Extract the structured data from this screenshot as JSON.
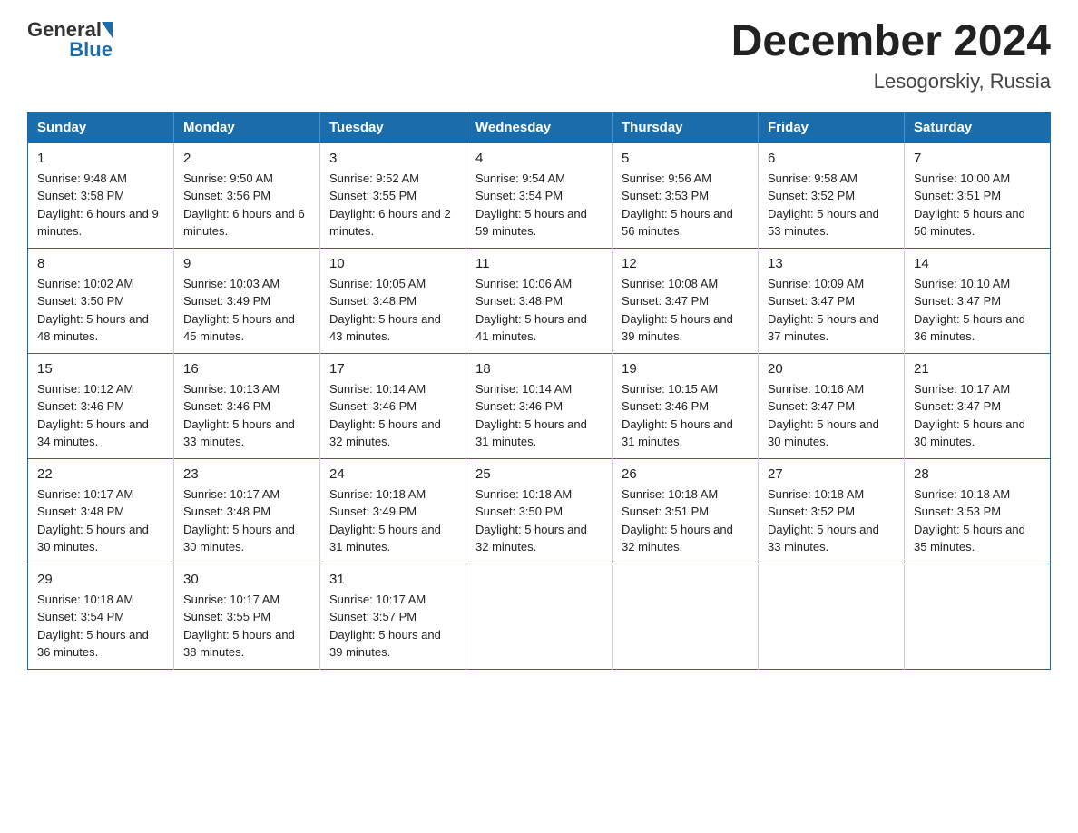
{
  "header": {
    "logo": {
      "text_general": "General",
      "text_blue": "Blue",
      "arrow_alt": "arrow icon"
    },
    "title": "December 2024",
    "subtitle": "Lesogorskiy, Russia"
  },
  "calendar": {
    "days_of_week": [
      "Sunday",
      "Monday",
      "Tuesday",
      "Wednesday",
      "Thursday",
      "Friday",
      "Saturday"
    ],
    "weeks": [
      [
        {
          "day": "1",
          "sunrise": "9:48 AM",
          "sunset": "3:58 PM",
          "daylight": "6 hours and 9 minutes."
        },
        {
          "day": "2",
          "sunrise": "9:50 AM",
          "sunset": "3:56 PM",
          "daylight": "6 hours and 6 minutes."
        },
        {
          "day": "3",
          "sunrise": "9:52 AM",
          "sunset": "3:55 PM",
          "daylight": "6 hours and 2 minutes."
        },
        {
          "day": "4",
          "sunrise": "9:54 AM",
          "sunset": "3:54 PM",
          "daylight": "5 hours and 59 minutes."
        },
        {
          "day": "5",
          "sunrise": "9:56 AM",
          "sunset": "3:53 PM",
          "daylight": "5 hours and 56 minutes."
        },
        {
          "day": "6",
          "sunrise": "9:58 AM",
          "sunset": "3:52 PM",
          "daylight": "5 hours and 53 minutes."
        },
        {
          "day": "7",
          "sunrise": "10:00 AM",
          "sunset": "3:51 PM",
          "daylight": "5 hours and 50 minutes."
        }
      ],
      [
        {
          "day": "8",
          "sunrise": "10:02 AM",
          "sunset": "3:50 PM",
          "daylight": "5 hours and 48 minutes."
        },
        {
          "day": "9",
          "sunrise": "10:03 AM",
          "sunset": "3:49 PM",
          "daylight": "5 hours and 45 minutes."
        },
        {
          "day": "10",
          "sunrise": "10:05 AM",
          "sunset": "3:48 PM",
          "daylight": "5 hours and 43 minutes."
        },
        {
          "day": "11",
          "sunrise": "10:06 AM",
          "sunset": "3:48 PM",
          "daylight": "5 hours and 41 minutes."
        },
        {
          "day": "12",
          "sunrise": "10:08 AM",
          "sunset": "3:47 PM",
          "daylight": "5 hours and 39 minutes."
        },
        {
          "day": "13",
          "sunrise": "10:09 AM",
          "sunset": "3:47 PM",
          "daylight": "5 hours and 37 minutes."
        },
        {
          "day": "14",
          "sunrise": "10:10 AM",
          "sunset": "3:47 PM",
          "daylight": "5 hours and 36 minutes."
        }
      ],
      [
        {
          "day": "15",
          "sunrise": "10:12 AM",
          "sunset": "3:46 PM",
          "daylight": "5 hours and 34 minutes."
        },
        {
          "day": "16",
          "sunrise": "10:13 AM",
          "sunset": "3:46 PM",
          "daylight": "5 hours and 33 minutes."
        },
        {
          "day": "17",
          "sunrise": "10:14 AM",
          "sunset": "3:46 PM",
          "daylight": "5 hours and 32 minutes."
        },
        {
          "day": "18",
          "sunrise": "10:14 AM",
          "sunset": "3:46 PM",
          "daylight": "5 hours and 31 minutes."
        },
        {
          "day": "19",
          "sunrise": "10:15 AM",
          "sunset": "3:46 PM",
          "daylight": "5 hours and 31 minutes."
        },
        {
          "day": "20",
          "sunrise": "10:16 AM",
          "sunset": "3:47 PM",
          "daylight": "5 hours and 30 minutes."
        },
        {
          "day": "21",
          "sunrise": "10:17 AM",
          "sunset": "3:47 PM",
          "daylight": "5 hours and 30 minutes."
        }
      ],
      [
        {
          "day": "22",
          "sunrise": "10:17 AM",
          "sunset": "3:48 PM",
          "daylight": "5 hours and 30 minutes."
        },
        {
          "day": "23",
          "sunrise": "10:17 AM",
          "sunset": "3:48 PM",
          "daylight": "5 hours and 30 minutes."
        },
        {
          "day": "24",
          "sunrise": "10:18 AM",
          "sunset": "3:49 PM",
          "daylight": "5 hours and 31 minutes."
        },
        {
          "day": "25",
          "sunrise": "10:18 AM",
          "sunset": "3:50 PM",
          "daylight": "5 hours and 32 minutes."
        },
        {
          "day": "26",
          "sunrise": "10:18 AM",
          "sunset": "3:51 PM",
          "daylight": "5 hours and 32 minutes."
        },
        {
          "day": "27",
          "sunrise": "10:18 AM",
          "sunset": "3:52 PM",
          "daylight": "5 hours and 33 minutes."
        },
        {
          "day": "28",
          "sunrise": "10:18 AM",
          "sunset": "3:53 PM",
          "daylight": "5 hours and 35 minutes."
        }
      ],
      [
        {
          "day": "29",
          "sunrise": "10:18 AM",
          "sunset": "3:54 PM",
          "daylight": "5 hours and 36 minutes."
        },
        {
          "day": "30",
          "sunrise": "10:17 AM",
          "sunset": "3:55 PM",
          "daylight": "5 hours and 38 minutes."
        },
        {
          "day": "31",
          "sunrise": "10:17 AM",
          "sunset": "3:57 PM",
          "daylight": "5 hours and 39 minutes."
        },
        null,
        null,
        null,
        null
      ]
    ],
    "labels": {
      "sunrise": "Sunrise:",
      "sunset": "Sunset:",
      "daylight": "Daylight:"
    }
  }
}
